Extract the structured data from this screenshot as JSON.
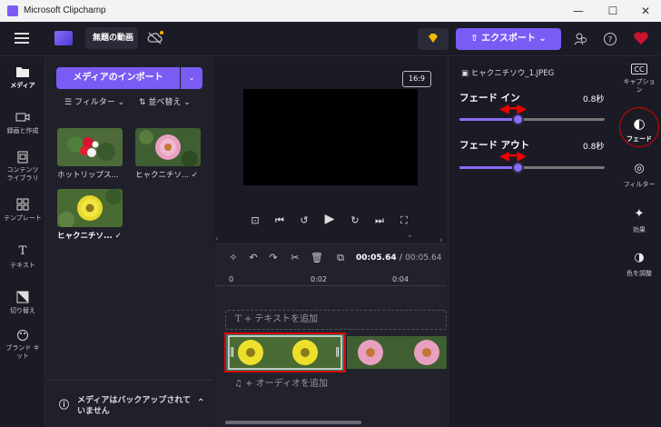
{
  "window": {
    "title": "Microsoft Clipchamp",
    "minimize": "—",
    "maximize": "☐",
    "close": "✕"
  },
  "header": {
    "project_name": "無題の動画",
    "export_label": "エクスポート"
  },
  "left_rail": {
    "items": [
      {
        "label": "メディア",
        "icon": "folder-icon"
      },
      {
        "label": "録画と作成",
        "icon": "camera-icon"
      },
      {
        "label": "コンテンツ ライブラリ",
        "icon": "library-icon"
      },
      {
        "label": "テンプレート",
        "icon": "templates-icon"
      },
      {
        "label": "テキスト",
        "icon": "text-icon"
      },
      {
        "label": "切り替え",
        "icon": "transitions-icon"
      },
      {
        "label": "ブランド キット",
        "icon": "brand-icon"
      }
    ]
  },
  "media": {
    "import_label": "メディアのインポート",
    "filter_label": "フィルター",
    "sort_label": "並べ替え",
    "items": [
      {
        "label": "ホットリップス..."
      },
      {
        "label": "ヒャクニチソ...",
        "check": "✓"
      },
      {
        "label": "ヒャクニチソ...",
        "check": "✓"
      }
    ],
    "backup_text": "メディアはバックアップされていません"
  },
  "preview": {
    "aspect_ratio": "16:9"
  },
  "timeline": {
    "current_time": "00:05.64",
    "separator": "/",
    "total_time": "00:05.64",
    "ticks": [
      "0",
      "0:02",
      "0:04"
    ],
    "text_track": "+ テキストを追加",
    "audio_track": "+ オーディオを追加"
  },
  "properties": {
    "file_name": "ヒャクニチソウ_1.JPEG",
    "fade_in": {
      "label": "フェード イン",
      "value": "0.8秒",
      "level": 0.4
    },
    "fade_out": {
      "label": "フェード アウト",
      "value": "0.8秒",
      "level": 0.4
    },
    "arrow": "◀━▶"
  },
  "right_rail": {
    "items": [
      {
        "label": "キャプション",
        "icon": "captions-icon",
        "glyph": "CC"
      },
      {
        "label": "フェード",
        "icon": "fade-icon",
        "glyph": "◐"
      },
      {
        "label": "フィルター",
        "icon": "filter-icon",
        "glyph": "◎"
      },
      {
        "label": "効果",
        "icon": "effects-icon",
        "glyph": "✦"
      },
      {
        "label": "色を調整",
        "icon": "color-adjust-icon",
        "glyph": "◑"
      }
    ]
  },
  "colors": {
    "accent": "#7a5cf5",
    "highlight": "#e00000"
  }
}
